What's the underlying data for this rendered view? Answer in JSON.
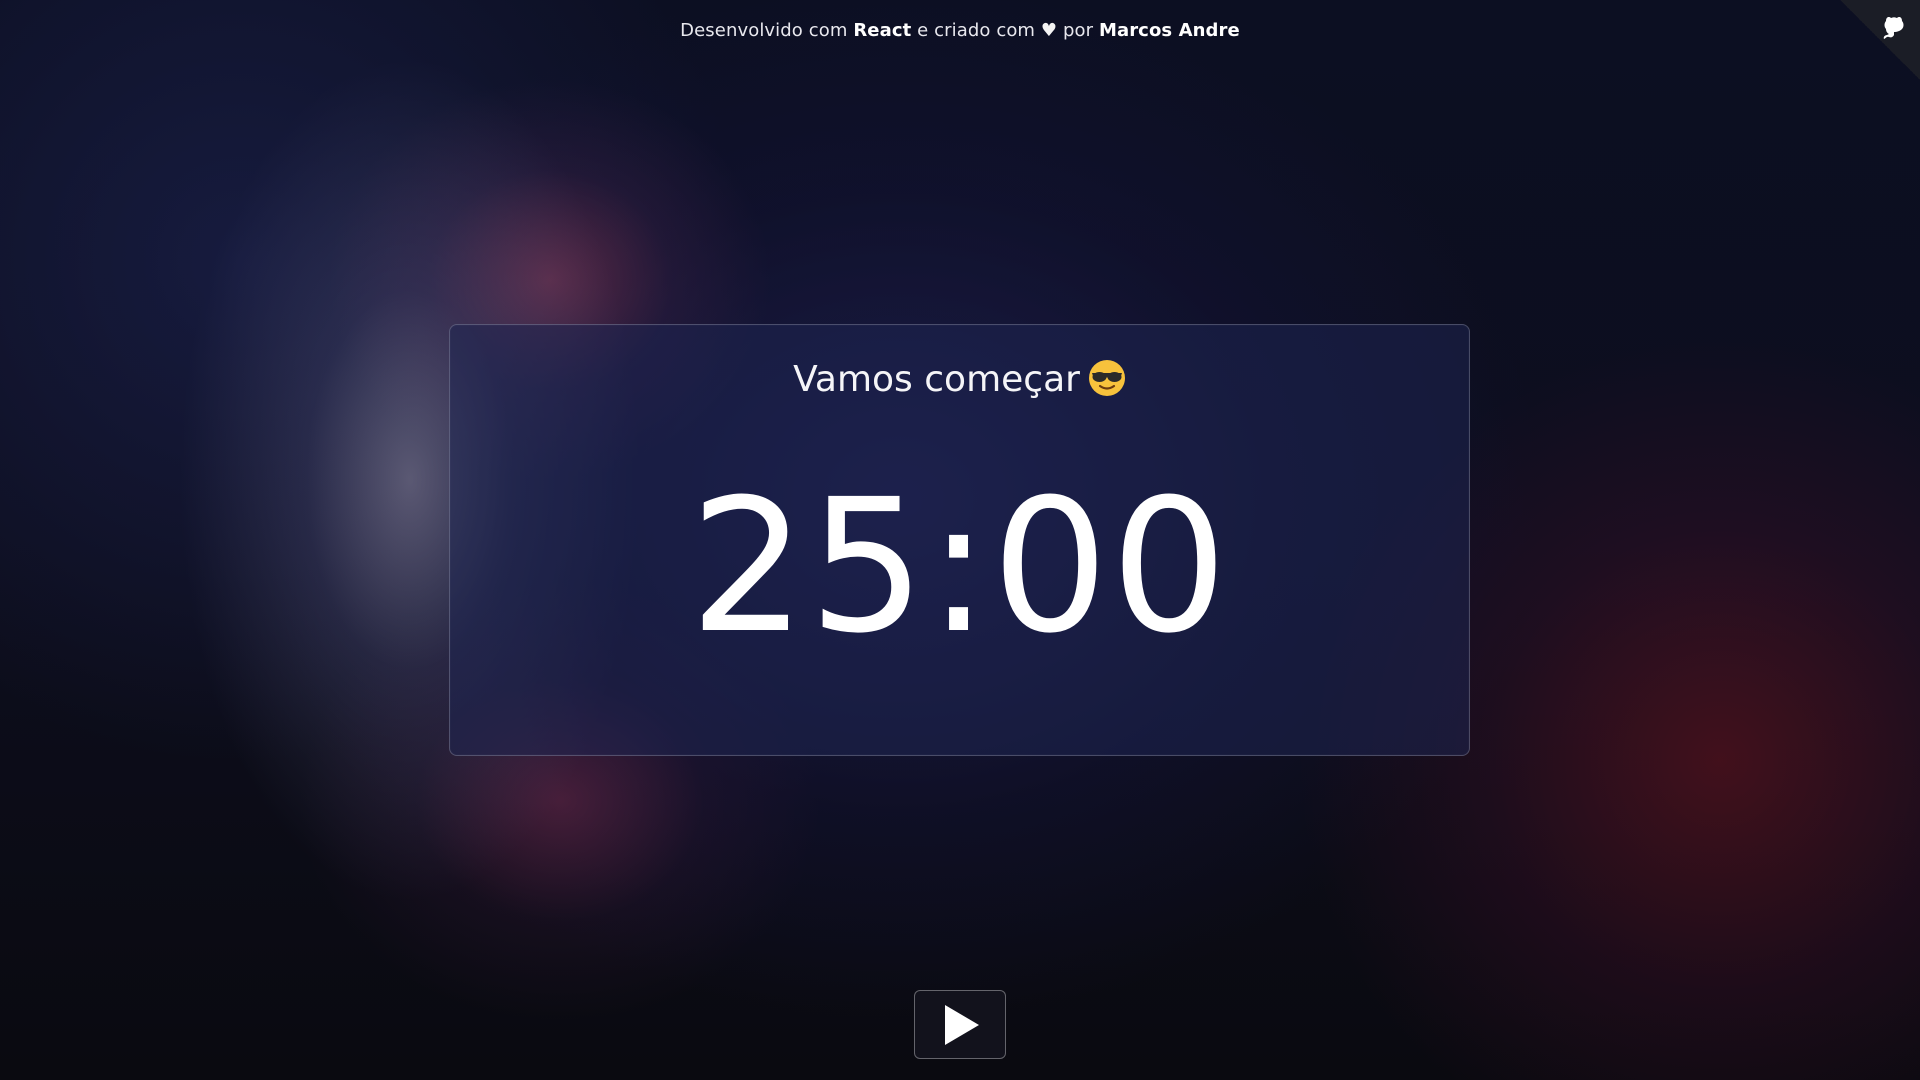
{
  "header": {
    "credit_prefix": "Desenvolvido com ",
    "credit_tech": "React",
    "credit_middle": " e criado com ",
    "heart_icon": "heart-icon",
    "credit_by": " por ",
    "credit_author": "Marcos Andre"
  },
  "corner": {
    "icon": "github-icon"
  },
  "timer_card": {
    "title": "Vamos começar",
    "title_icon": "sunglasses-emoji-icon",
    "time": "25:00"
  },
  "controls": {
    "play_icon": "play-icon"
  },
  "colors": {
    "text": "#ffffff",
    "card_border": "rgba(255,255,255,0.22)",
    "button_bg": "#12121c"
  }
}
